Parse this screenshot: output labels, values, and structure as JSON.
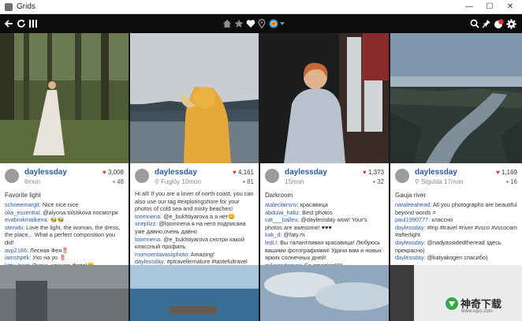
{
  "window": {
    "title": "Grids",
    "minimize": "—",
    "maximize": "☐",
    "close": "✕"
  },
  "toolbar": {
    "left_icons": [
      "back-arrow-icon",
      "refresh-icon",
      "grid-columns-icon"
    ],
    "center_icons": [
      "home-icon",
      "star-icon",
      "heart-icon",
      "location-pin-icon",
      "account-icon",
      "dropdown-caret-icon"
    ],
    "right_icons": [
      "search-icon",
      "pin-icon",
      "notifications-icon",
      "gear-icon"
    ]
  },
  "posts": [
    {
      "user": "daylessday",
      "location": "8mon",
      "likes": "3,008",
      "comments": "48",
      "caption": "Favorite light",
      "comment_list": [
        {
          "user": "schneemargit:",
          "text": " Nice nice nice"
        },
        {
          "user": "olia_essential:",
          "text": " @alyona.tolstikova посмотри"
        },
        {
          "user": "evabrokmalkena:",
          "text": " 🐝🐝"
        },
        {
          "user": "sterwbi:",
          "text": " Love the light, the woman, the dress, the place... What a perfect composition you did!",
          "wrap": true
        },
        {
          "user": "avp2166:",
          "text": " Лесная Фея🌷"
        },
        {
          "user": "iamshpek:",
          "text": " Ухо на уо 🌷"
        },
        {
          "user": "kitty_bast:",
          "text": " Очень нежное фото!😊"
        }
      ]
    },
    {
      "user": "daylessday",
      "location": "Fuglóy",
      "time": "10mon",
      "likes": "4,161",
      "comments": "81",
      "caption": "",
      "comment_list": [
        {
          "user": "",
          "text": "Hi all! If you are a lover of north coast, you can also use our tag #exploringshore for your photos of cold sea and misty beaches!",
          "wrap": true
        },
        {
          "user": "loomnena:",
          "text": " @e_bukhtiyarova а я нет😊"
        },
        {
          "user": "sneplizz:",
          "text": " @loomnena я на него подписана уже давно,очень давно",
          "wrap": true
        },
        {
          "user": "loomnena:",
          "text": " @e_bukhtiyarova снотри какой классный профиль",
          "wrap": true
        },
        {
          "user": "momsentavasiiphoto:",
          "text": " Amazing!"
        },
        {
          "user": "daylessday:",
          "text": " #ptravellernature #tastefultravel"
        }
      ]
    },
    {
      "user": "daylessday",
      "location": "15mon",
      "likes": "1,373",
      "comments": "32",
      "caption": "Darkroom",
      "comment_list": [
        {
          "user": "ataleclairsnv:",
          "text": " красавица"
        },
        {
          "user": "abdulai_hafiz:",
          "text": " Best photos"
        },
        {
          "user": "cat___balleu:",
          "text": " @daylessday wow! Your's photos are awesome! ♥♥♥",
          "wrap": true
        },
        {
          "user": "kak_d:",
          "text": " @faty.m"
        },
        {
          "user": "ledi.l:",
          "text": " Вы талантливая красавица! Любуюсь вашими фотографиями! Удачи вам и новых ярких солнечных дней!",
          "wrap": true
        },
        {
          "user": "mikaandomeri:",
          "text": " So amazing!!!!!"
        }
      ]
    },
    {
      "user": "daylessday",
      "location": "Sigulda",
      "time": "17mon",
      "likes": "1,169",
      "comments": "16",
      "caption": "Gauja river",
      "comment_list": [
        {
          "user": "nataleeahead:",
          "text": " All you photographs are beautiful beyond words =",
          "wrap": true
        },
        {
          "user": "paul1990777:",
          "text": " классно"
        },
        {
          "user": "daylessday:",
          "text": " #trip #travel #river #vsco #vscocam #afterlight",
          "wrap": true
        },
        {
          "user": "daylessday:",
          "text": " @nadyassidedtheread здесь прекрасно)",
          "wrap": true
        },
        {
          "user": "daylessday:",
          "text": " @katyakogen спасибо)"
        }
      ]
    }
  ],
  "watermark": {
    "text": "神奇下载",
    "sub": "www.sqxz.com"
  },
  "colors": {
    "toolbar": "#0d0d0d",
    "link": "#2a5aa8",
    "like": "#e0312d"
  }
}
